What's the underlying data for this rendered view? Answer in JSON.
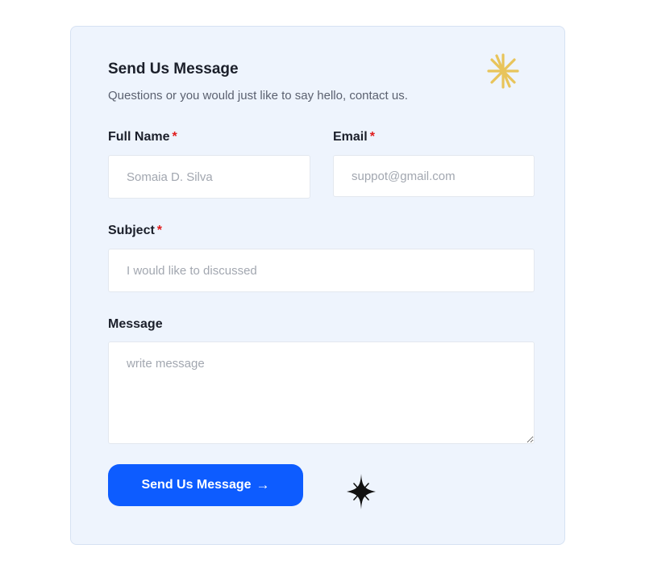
{
  "form": {
    "title": "Send Us Message",
    "subtitle": "Questions or you would just like to say hello, contact us.",
    "required_marker": "*",
    "full_name": {
      "label": "Full Name",
      "placeholder": "Somaia D. Silva",
      "value": ""
    },
    "email": {
      "label": "Email",
      "placeholder": "suppot@gmail.com",
      "value": ""
    },
    "subject": {
      "label": "Subject",
      "placeholder": "I would like to discussed",
      "value": ""
    },
    "message": {
      "label": "Message",
      "placeholder": "write message",
      "value": ""
    },
    "submit_label": "Send Us Message",
    "submit_arrow": "→"
  },
  "decorations": {
    "top_sparkle_icon": "sparkle-icon",
    "top_sparkle_color": "#e8c45a",
    "bottom_sparkle_icon": "four-point-star-icon",
    "bottom_sparkle_color": "#111111"
  },
  "colors": {
    "card_background": "#eef4fd",
    "accent": "#0d5cff",
    "required": "#e01b1b"
  }
}
